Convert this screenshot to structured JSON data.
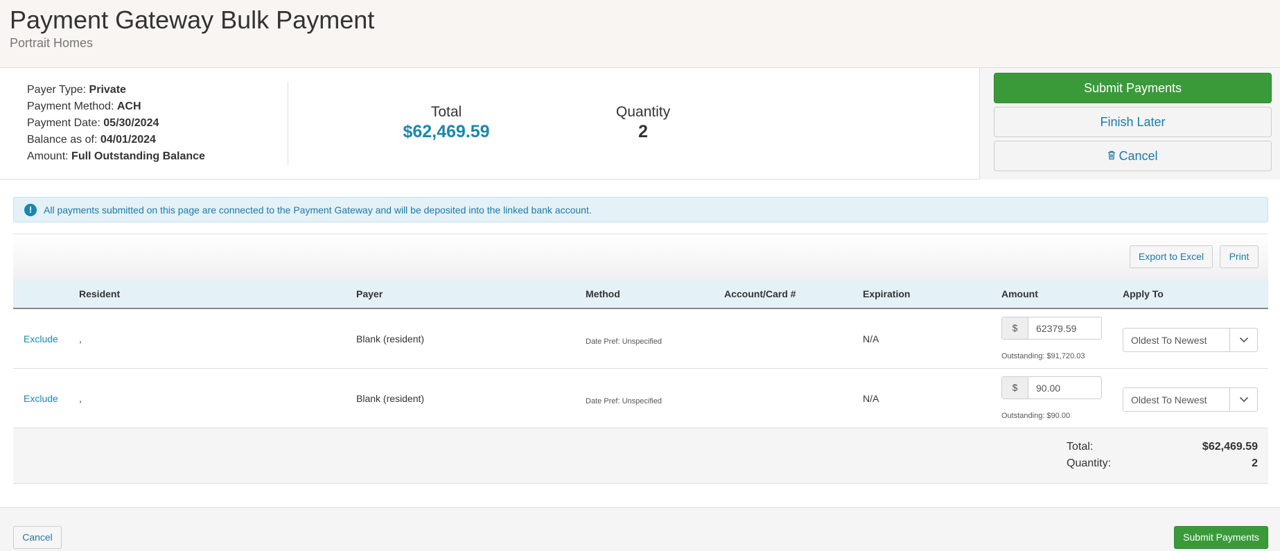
{
  "header": {
    "title": "Payment Gateway Bulk Payment",
    "subtitle": "Portrait Homes"
  },
  "summary": {
    "payer_type_label": "Payer Type:",
    "payer_type": "Private",
    "payment_method_label": "Payment Method:",
    "payment_method": "ACH",
    "payment_date_label": "Payment Date:",
    "payment_date": "05/30/2024",
    "balance_as_of_label": "Balance as of:",
    "balance_as_of": "04/01/2024",
    "amount_label": "Amount:",
    "amount": "Full Outstanding Balance",
    "total_label": "Total",
    "total_value": "$62,469.59",
    "quantity_label": "Quantity",
    "quantity_value": "2"
  },
  "actions": {
    "submit": "Submit Payments",
    "finish_later": "Finish Later",
    "cancel": "Cancel"
  },
  "alert": {
    "text": "All payments submitted on this page are connected to the Payment Gateway and will be deposited into the linked bank account."
  },
  "toolbar": {
    "export": "Export to Excel",
    "print": "Print"
  },
  "table": {
    "columns": [
      "Resident",
      "Payer",
      "Method",
      "Account/Card #",
      "Expiration",
      "Amount",
      "Apply To"
    ],
    "rows": [
      {
        "exclude": "Exclude",
        "resident": ",",
        "payer": "Blank (resident)",
        "method": "Date Pref: Unspecified",
        "account": "",
        "expiration": "N/A",
        "currency": "$",
        "amount": "62379.59",
        "outstanding": "Outstanding: $91,720.03",
        "apply_to": "Oldest To Newest"
      },
      {
        "exclude": "Exclude",
        "resident": ",",
        "payer": "Blank (resident)",
        "method": "Date Pref: Unspecified",
        "account": "",
        "expiration": "N/A",
        "currency": "$",
        "amount": "90.00",
        "outstanding": "Outstanding: $90.00",
        "apply_to": "Oldest To Newest"
      }
    ],
    "footer": {
      "total_label": "Total:",
      "total_value": "$62,469.59",
      "quantity_label": "Quantity:",
      "quantity_value": "2"
    }
  },
  "footer": {
    "cancel": "Cancel",
    "submit": "Submit Payments"
  },
  "colors": {
    "accent": "#1a87b0",
    "success": "#3a9a3a",
    "info_bg": "#e4f1f7"
  },
  "icons": {
    "alert": "exclamation-circle-icon",
    "trash": "trash-icon",
    "chevron": "chevron-down-icon"
  }
}
